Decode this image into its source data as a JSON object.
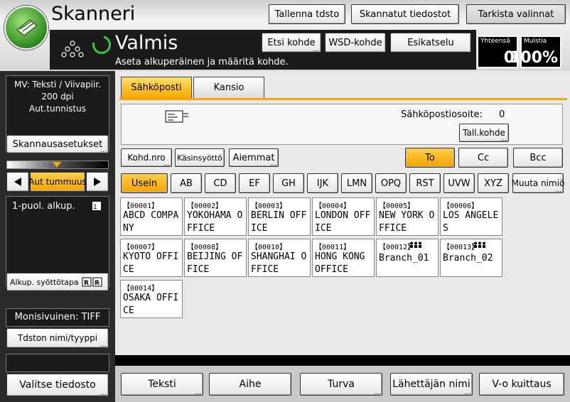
{
  "app": {
    "title": "Skanneri",
    "status": "Valmis",
    "status_sub": "Aseta alkuperäinen ja määritä kohde."
  },
  "header_buttons": {
    "save_file": "Tallenna tdsto",
    "scanned_files": "Skannatut tiedostot",
    "check_settings": "Tarkista valinnat",
    "search_dest": "Etsi kohde",
    "wsd_dest": "WSD-kohde",
    "preview": "Esikatselu"
  },
  "counters": {
    "total_label": "Yhteensä",
    "total_value": "0",
    "memory_label": "Muistia",
    "memory_value": "100%"
  },
  "left_panel": {
    "scan_info_line1": "MV: Teksti / Viivapiir.",
    "scan_info_line2": "200 dpi",
    "scan_info_line3": "Aut.tunnistus",
    "scan_settings": "Skannausasetukset",
    "auto_density": "Aut tummuus",
    "original_type": "1-puol. alkup.",
    "original_feed": "Alkup. syöttötapa",
    "multipage": "Monisivuinen: TIFF",
    "file_name_type": "Tdston nimi/tyyppi",
    "select_file": "Valitse tiedosto"
  },
  "tabs": {
    "email": "Sähköposti",
    "folder": "Kansio"
  },
  "email_area": {
    "address_label": "Sähköpostiosoite:",
    "address_count": "0",
    "save_dest": "Tall.kohde"
  },
  "dest_controls": {
    "manual_dest": "Kohd.nro",
    "manual_input": "Käsinsyöttö",
    "previous": "Aiemmat",
    "to": "To",
    "cc": "Cc",
    "bcc": "Bcc"
  },
  "index_tabs": [
    "Usein",
    "AB",
    "CD",
    "EF",
    "GH",
    "IJK",
    "LMN",
    "OPQ",
    "RST",
    "UVW",
    "XYZ",
    "Muuta nimiö"
  ],
  "destinations": [
    {
      "id": "【00001】",
      "name": "ABCD COMPANY"
    },
    {
      "id": "【00002】",
      "name": "YOKOHAMA OFFICE"
    },
    {
      "id": "【00003】",
      "name": "BERLIN OFFICE"
    },
    {
      "id": "【00004】",
      "name": "LONDON OFFICE"
    },
    {
      "id": "【00005】",
      "name": "NEW YORK OFFICE"
    },
    {
      "id": "【00006】",
      "name": "LOS ANGELES"
    },
    {
      "id": "【00007】",
      "name": "KYOTO OFFICE"
    },
    {
      "id": "【00008】",
      "name": "BEIJING OFFICE"
    },
    {
      "id": "【00010】",
      "name": "SHANGHAI OFFICE"
    },
    {
      "id": "【00011】",
      "name": "HONG KONG OFFICE"
    },
    {
      "id": "【00012】",
      "name": "Branch_01"
    },
    {
      "id": "【00013】",
      "name": "Branch_02"
    },
    {
      "id": "【00014】",
      "name": "OSAKA OFFICE"
    }
  ],
  "bottom_buttons": {
    "text": "Teksti",
    "subject": "Aihe",
    "security": "Turva",
    "sender_name": "Lähettäjän nimi",
    "read_receipt": "V-o kuittaus"
  }
}
